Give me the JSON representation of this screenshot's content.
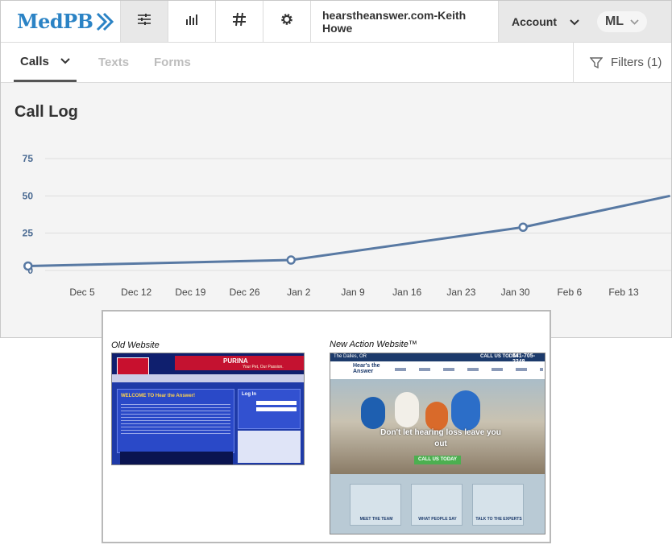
{
  "brand": {
    "logo_text": "MedPB",
    "accent": "#2b83c5"
  },
  "nav": {
    "icons": [
      "equalizer-icon",
      "bar-chart-icon",
      "hash-icon",
      "gear-icon"
    ],
    "site_name": "hearstheanswer.com-Keith Howe",
    "account_label": "Account",
    "user_initials": "ML"
  },
  "subnav": {
    "tabs": [
      {
        "label": "Calls",
        "active": true
      },
      {
        "label": "Texts",
        "active": false
      },
      {
        "label": "Forms",
        "active": false
      }
    ],
    "filters_label": "Filters (1)"
  },
  "page": {
    "title": "Call Log"
  },
  "chart_data": {
    "type": "line",
    "x": [
      "Nov 28",
      "Jan 1",
      "Jan 31",
      "Feb 19"
    ],
    "values": [
      3,
      7,
      29,
      50
    ],
    "x_ticks": [
      "Dec 5",
      "Dec 12",
      "Dec 19",
      "Dec 26",
      "Jan 2",
      "Jan 9",
      "Jan 16",
      "Jan 23",
      "Jan 30",
      "Feb 6",
      "Feb 13"
    ],
    "y_ticks": [
      0,
      25,
      50,
      75
    ],
    "ylim": [
      0,
      75
    ],
    "grid": true,
    "line_color": "#5879a3"
  },
  "overlay": {
    "old_label": "Old Website",
    "new_label": "New Action Website™",
    "old_site": {
      "brand": "PURINA",
      "tagline": "Your Pet, Our Passion.",
      "welcome": "WELCOME TO Hear the Answer!",
      "login": "Log In"
    },
    "new_site": {
      "location": "The Dalles, OR",
      "call_label": "CALL US TODAY",
      "phone": "541-705-2248",
      "logo": "Hear's the Answer",
      "menu": [
        "Hearing Loss",
        "Hearing Aids",
        "Services",
        "About Us",
        "Contact Us",
        "Review Us"
      ],
      "headline": "Don't let hearing loss leave you out",
      "cta": "CALL US TODAY",
      "cards": [
        "MEET THE TEAM",
        "WHAT PEOPLE SAY",
        "TALK TO THE EXPERTS"
      ]
    }
  }
}
